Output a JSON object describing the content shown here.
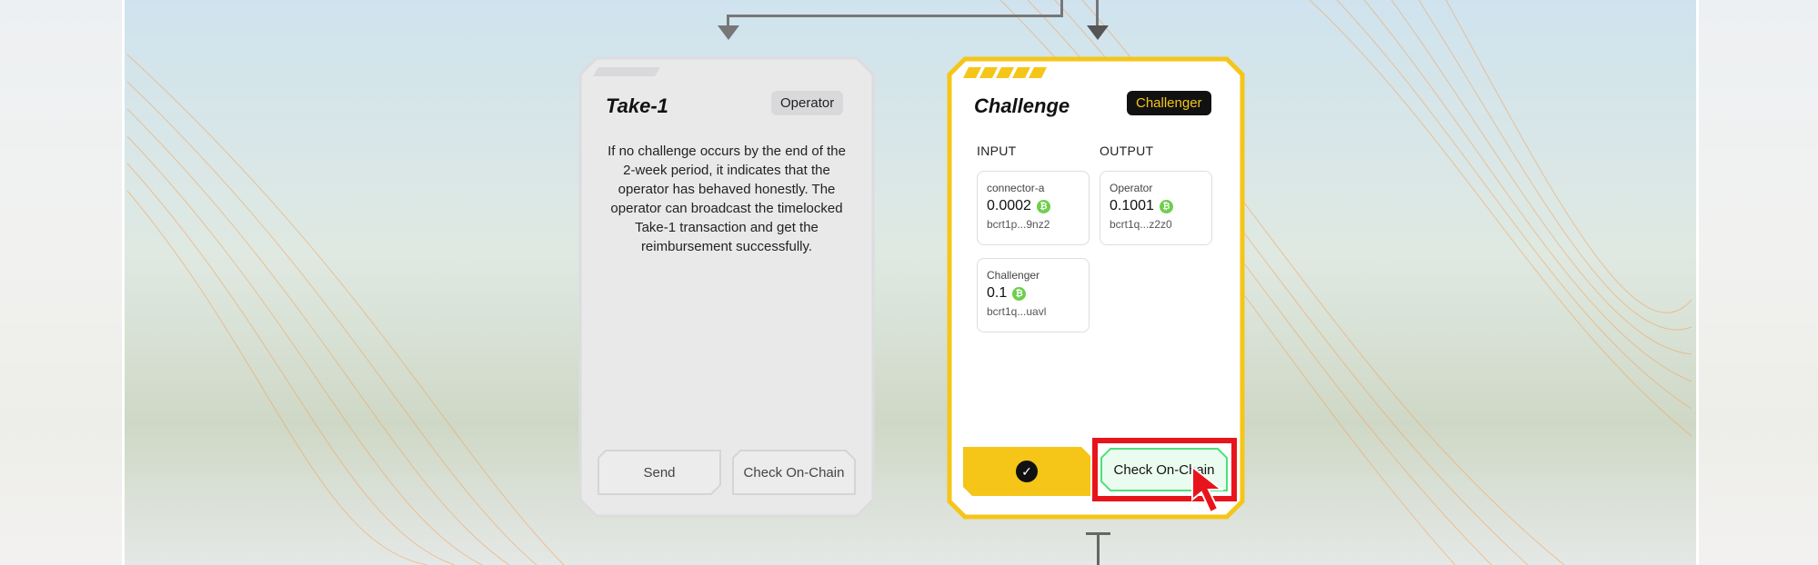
{
  "take1": {
    "title": "Take-1",
    "badge": "Operator",
    "description": "If no challenge occurs by the end of the 2-week period, it indicates that the operator has behaved honestly. The operator can broadcast the timelocked Take-1 transaction and get the reimbursement successfully.",
    "send_label": "Send",
    "check_label": "Check On-Chain"
  },
  "challenge": {
    "title": "Challenge",
    "badge": "Challenger",
    "input_header": "INPUT",
    "output_header": "OUTPUT",
    "inputs": [
      {
        "name": "connector-a",
        "amount": "0.0002",
        "address": "bcrt1p...9nz2"
      },
      {
        "name": "Challenger",
        "amount": "0.1",
        "address": "bcrt1q...uavl"
      }
    ],
    "outputs": [
      {
        "name": "Operator",
        "amount": "0.1001",
        "address": "bcrt1q...z2z0"
      }
    ],
    "check_label": "Check On-Chain"
  },
  "colors": {
    "accent": "#f5c518",
    "highlight_box": "#e8141b",
    "confirm_green": "#4ee07a",
    "btc_icon": "#6dcf4b"
  },
  "icons": {
    "btc": "bitcoin-icon",
    "check": "check-circle-icon",
    "cursor": "cursor-icon"
  }
}
